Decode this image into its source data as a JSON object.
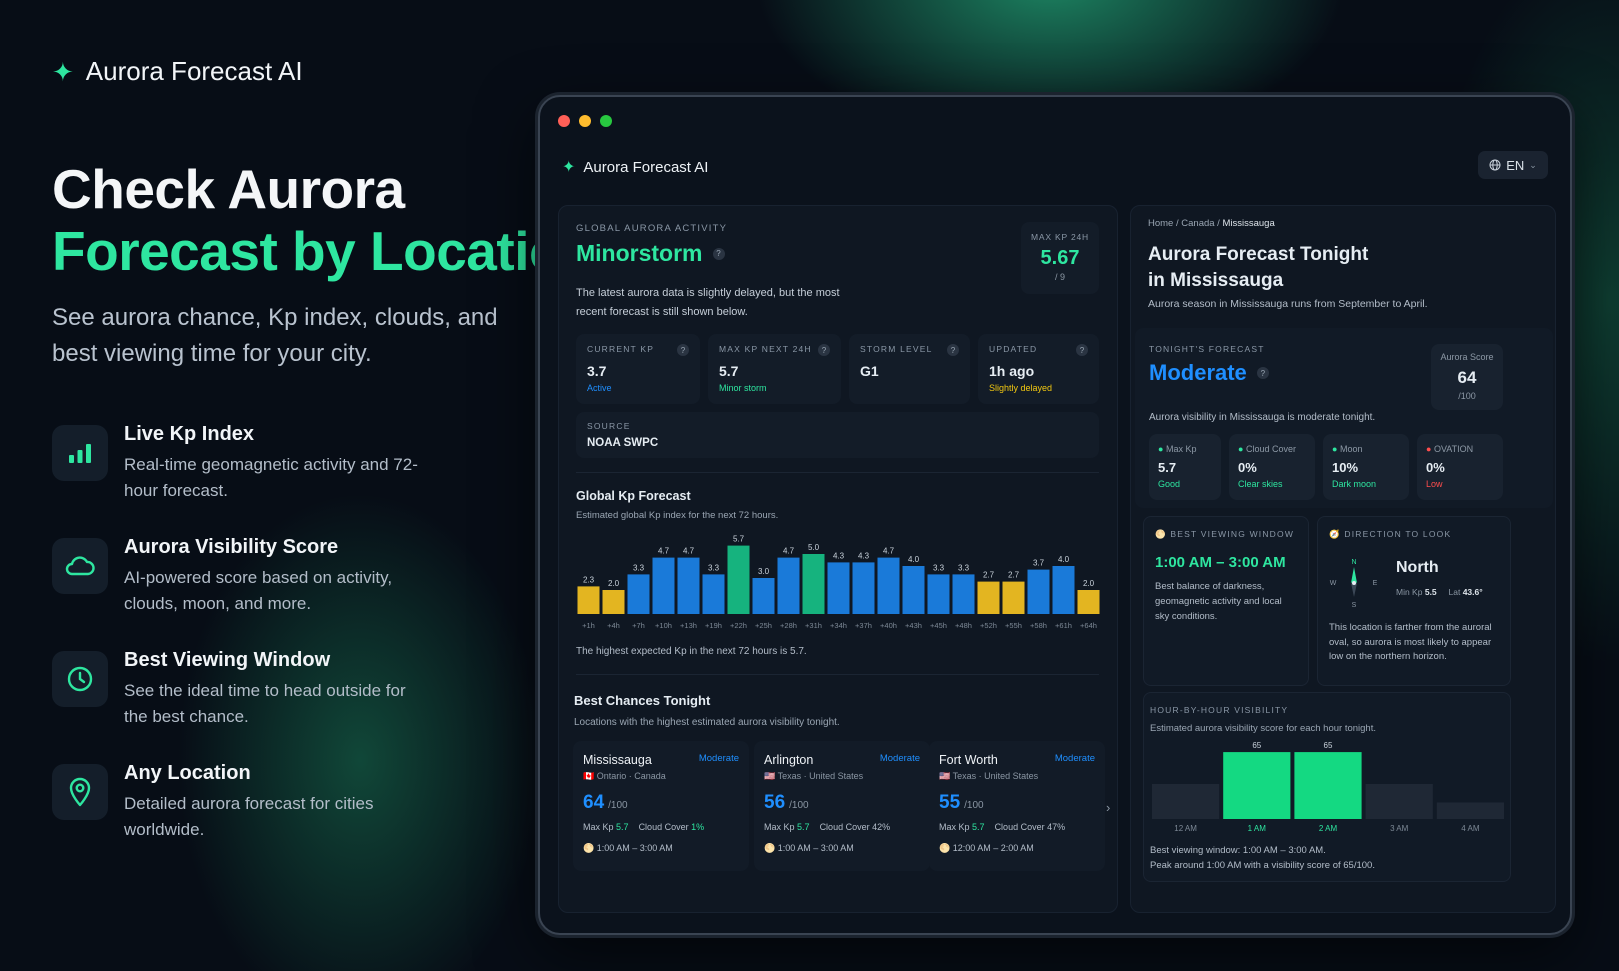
{
  "hero": {
    "brand": "Aurora Forecast AI",
    "headline_line1": "Check Aurora",
    "headline_line2": "Forecast by Location",
    "subhead": "See aurora chance, Kp index, clouds, and best viewing time for your city.",
    "features": [
      {
        "icon": "bar-chart-icon",
        "title": "Live Kp Index",
        "desc": "Real-time geomagnetic activity and 72-hour forecast."
      },
      {
        "icon": "cloud-icon",
        "title": "Aurora Visibility Score",
        "desc": "AI-powered score based on activity, clouds, moon, and more."
      },
      {
        "icon": "clock-icon",
        "title": "Best Viewing Window",
        "desc": "See the ideal time to head outside for the best chance."
      },
      {
        "icon": "map-pin-icon",
        "title": "Any Location",
        "desc": "Detailed aurora forecast for cities worldwide."
      }
    ]
  },
  "app": {
    "name": "Aurora Forecast AI",
    "lang": "EN"
  },
  "global": {
    "section_label": "GLOBAL AURORA ACTIVITY",
    "status": "Minorstorm",
    "note": "The latest aurora data is slightly delayed, but the most recent forecast is still shown below.",
    "maxkp_label": "MAX KP 24H",
    "maxkp_value": "5.67",
    "maxkp_scale": "/ 9",
    "stats": [
      {
        "label": "CURRENT KP",
        "value": "3.7",
        "sub": "Active"
      },
      {
        "label": "MAX KP NEXT 24H",
        "value": "5.7",
        "sub": "Minor storm"
      },
      {
        "label": "STORM LEVEL",
        "value": "G1",
        "sub": ""
      },
      {
        "label": "UPDATED",
        "value": "1h ago",
        "sub": "Slightly delayed"
      }
    ],
    "source_label": "SOURCE",
    "source_value": "NOAA SWPC"
  },
  "kp_forecast": {
    "title": "Global Kp Forecast",
    "subtitle": "Estimated global Kp index for the next 72 hours.",
    "footer": "The highest expected Kp in the next 72 hours is 5.7."
  },
  "chart_data": [
    {
      "type": "bar",
      "categories": [
        "+1h",
        "+4h",
        "+7h",
        "+10h",
        "+13h",
        "+19h",
        "+22h",
        "+25h",
        "+28h",
        "+31h",
        "+34h",
        "+37h",
        "+40h",
        "+43h",
        "+45h",
        "+48h",
        "+52h",
        "+55h",
        "+58h",
        "+61h",
        "+64h"
      ],
      "values": [
        2.3,
        2.0,
        3.3,
        4.7,
        4.7,
        3.3,
        5.7,
        3.0,
        4.7,
        5.0,
        4.3,
        4.3,
        4.7,
        4.0,
        3.3,
        3.3,
        2.7,
        2.7,
        3.7,
        4.0,
        2.0
      ],
      "colors": [
        "#e3b521",
        "#e3b521",
        "#1a7ad9",
        "#1a7ad9",
        "#1a7ad9",
        "#1a7ad9",
        "#16b37e",
        "#1a7ad9",
        "#1a7ad9",
        "#16b37e",
        "#1a7ad9",
        "#1a7ad9",
        "#1a7ad9",
        "#1a7ad9",
        "#1a7ad9",
        "#1a7ad9",
        "#e3b521",
        "#e3b521",
        "#1a7ad9",
        "#1a7ad9",
        "#e3b521"
      ],
      "ylim": [
        0,
        6
      ]
    },
    {
      "type": "bar",
      "categories": [
        "12 AM",
        "1 AM",
        "2 AM",
        "3 AM",
        "4 AM"
      ],
      "values": [
        34,
        65,
        65,
        34,
        16
      ],
      "labels": [
        "",
        "65",
        "65",
        "",
        ""
      ],
      "highlight": [
        false,
        true,
        true,
        false,
        false
      ],
      "ylim": [
        0,
        70
      ]
    }
  ],
  "best_chances": {
    "title": "Best Chances Tonight",
    "subtitle": "Locations with the highest estimated aurora visibility tonight.",
    "cities": [
      {
        "name": "Mississauga",
        "badge": "Moderate",
        "flag": "🇨🇦",
        "region": "Ontario · Canada",
        "score": "64",
        "scale": "/100",
        "maxkp_label": "Max Kp",
        "maxkp": "5.7",
        "cloud_label": "Cloud Cover",
        "cloud": "1%",
        "time": "1:00 AM – 3:00 AM"
      },
      {
        "name": "Arlington",
        "badge": "Moderate",
        "flag": "🇺🇸",
        "region": "Texas · United States",
        "score": "56",
        "scale": "/100",
        "maxkp_label": "Max Kp",
        "maxkp": "5.7",
        "cloud_label": "Cloud Cover",
        "cloud": "42%",
        "time": "1:00 AM – 3:00 AM"
      },
      {
        "name": "Fort Worth",
        "badge": "Moderate",
        "flag": "🇺🇸",
        "region": "Texas · United States",
        "score": "55",
        "scale": "/100",
        "maxkp_label": "Max Kp",
        "maxkp": "5.7",
        "cloud_label": "Cloud Cover",
        "cloud": "47%",
        "time": "12:00 AM – 2:00 AM"
      }
    ]
  },
  "location": {
    "breadcrumb": [
      "Home",
      "Canada",
      "Mississauga"
    ],
    "title_line1": "Aurora Forecast Tonight",
    "title_line2": "in Mississauga",
    "season": "Aurora season in Mississauga runs from September to April.",
    "tonight_label": "TONIGHT'S FORECAST",
    "tonight_status": "Moderate",
    "score_label": "Aurora Score",
    "score": "64",
    "score_scale": "/100",
    "visibility_note": "Aurora visibility in Mississauga is moderate tonight.",
    "metrics": [
      {
        "label": "Max Kp",
        "value": "5.7",
        "sub": "Good",
        "dot": "#2ee6a0"
      },
      {
        "label": "Cloud Cover",
        "value": "0%",
        "sub": "Clear skies",
        "dot": "#2ee6a0"
      },
      {
        "label": "Moon",
        "value": "10%",
        "sub": "Dark moon",
        "dot": "#2ee6a0"
      },
      {
        "label": "OVATION",
        "value": "0%",
        "sub": "Low",
        "dot": "#ff4d4d"
      }
    ],
    "window_label": "BEST VIEWING WINDOW",
    "window_time": "1:00 AM – 3:00 AM",
    "window_desc": "Best balance of darkness, geomagnetic activity and local sky conditions.",
    "direction_label": "DIRECTION TO LOOK",
    "direction": "North",
    "min_kp_label": "Min Kp",
    "min_kp": "5.5",
    "lat_label": "Lat",
    "lat": "43.6°",
    "compass": [
      "N",
      "E",
      "S",
      "W"
    ],
    "direction_desc": "This location is farther from the auroral oval, so aurora is most likely to appear low on the northern horizon.",
    "hourly_label": "HOUR-BY-HOUR VISIBILITY",
    "hourly_subtitle": "Estimated aurora visibility score for each hour tonight.",
    "hourly_footer1": "Best viewing window: 1:00 AM – 3:00 AM.",
    "hourly_footer2": "Peak around 1:00 AM with a visibility score of 65/100."
  },
  "colors": {
    "accent_green": "#2ee6a0",
    "accent_blue": "#1f8fff",
    "warning_yellow": "#f2c811",
    "danger_red": "#ff4d4d"
  }
}
